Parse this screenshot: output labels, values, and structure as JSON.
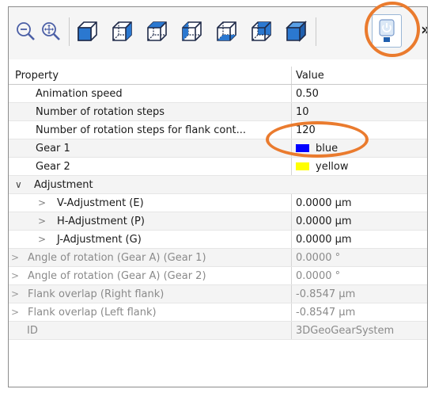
{
  "toolbar": {
    "tools": [
      {
        "name": "zoom-out",
        "icon": "zoom-out-icon"
      },
      {
        "name": "zoom-fit",
        "icon": "zoom-fit-icon"
      },
      {
        "name": "view-1",
        "icon": "cube-view-icon"
      },
      {
        "name": "view-2",
        "icon": "cube-view-icon"
      },
      {
        "name": "view-3",
        "icon": "cube-view-icon"
      },
      {
        "name": "view-4",
        "icon": "cube-view-icon"
      },
      {
        "name": "view-5",
        "icon": "cube-view-icon"
      },
      {
        "name": "view-6",
        "icon": "cube-view-icon"
      },
      {
        "name": "view-iso",
        "icon": "cube-solid-icon"
      },
      {
        "name": "power-tool",
        "icon": "power-icon"
      }
    ],
    "overflow_label": "»",
    "highlight_color": "#ea7b2e"
  },
  "grid": {
    "header": {
      "property": "Property",
      "value": "Value"
    },
    "rows": [
      {
        "label": "Animation speed",
        "value": "0.50"
      },
      {
        "label": "Number of rotation steps",
        "value": "10"
      },
      {
        "label": "Number of rotation steps for flank cont...",
        "value": "120"
      },
      {
        "label": "Gear 1",
        "value": "blue",
        "color": "#0000ff"
      },
      {
        "label": "Gear 2",
        "value": "yellow",
        "color": "#ffff00"
      },
      {
        "label": "Adjustment",
        "value": ""
      },
      {
        "label": "V-Adjustment (E)",
        "value": "0.0000 µm"
      },
      {
        "label": "H-Adjustment (P)",
        "value": "0.0000 µm"
      },
      {
        "label": "J-Adjustment (G)",
        "value": "0.0000 µm"
      },
      {
        "label": "Angle of rotation (Gear A) (Gear 1)",
        "value": "0.0000 °"
      },
      {
        "label": "Angle of rotation (Gear A) (Gear 2)",
        "value": "0.0000 °"
      },
      {
        "label": "Flank overlap (Right flank)",
        "value": "-0.8547 µm"
      },
      {
        "label": "Flank overlap (Left flank)",
        "value": "-0.8547 µm"
      },
      {
        "label": "ID",
        "value": "3DGeoGearSystem"
      }
    ]
  }
}
